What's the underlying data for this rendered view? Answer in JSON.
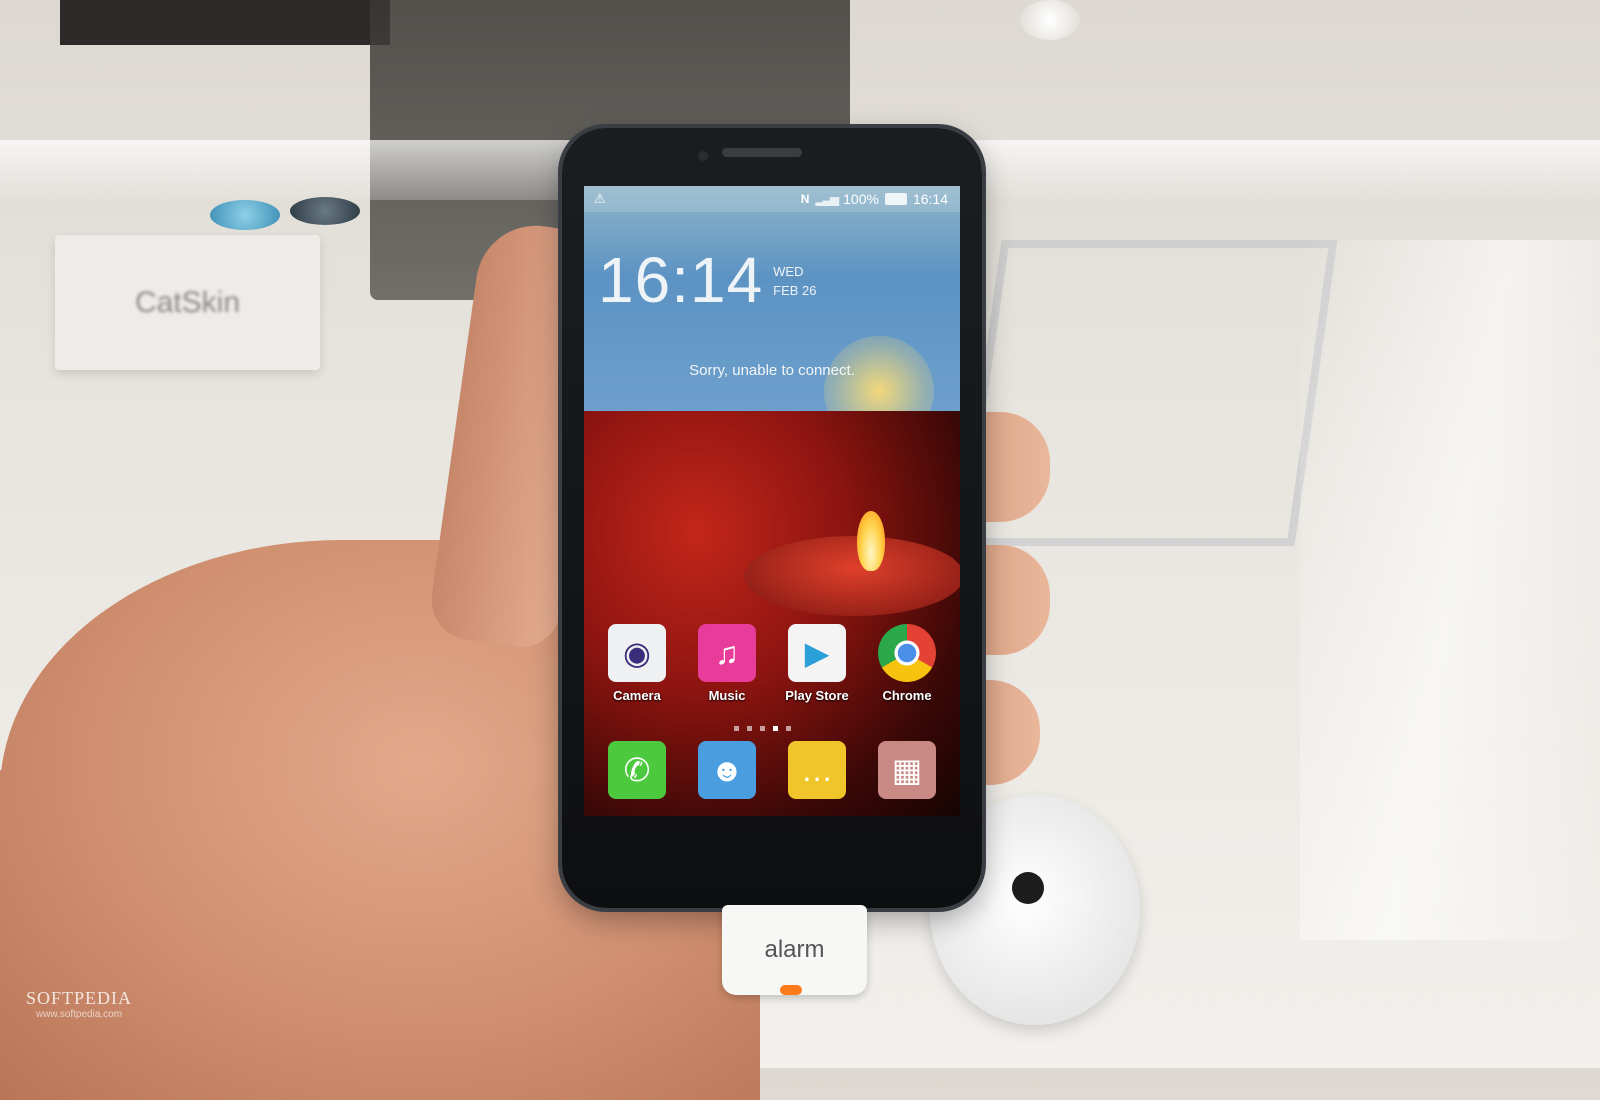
{
  "scene": {
    "background_card_text": "CatSkin",
    "alarm_label": "alarm"
  },
  "phone": {
    "status_bar": {
      "battery": "100%",
      "time": "16:14"
    },
    "clock_widget": {
      "time": "16:14",
      "day": "WED",
      "date": "FEB 26"
    },
    "weather_message": "Sorry, unable to connect.",
    "home_apps": [
      {
        "label": "Camera",
        "icon": "camera-icon"
      },
      {
        "label": "Music",
        "icon": "music-note-icon"
      },
      {
        "label": "Play Store",
        "icon": "play-store-icon"
      },
      {
        "label": "Chrome",
        "icon": "chrome-icon"
      }
    ],
    "dock_apps": [
      {
        "icon": "phone-icon"
      },
      {
        "icon": "contacts-icon"
      },
      {
        "icon": "messages-icon"
      },
      {
        "icon": "app-drawer-icon"
      }
    ],
    "page_indicator": {
      "pages": 5,
      "active": 4
    }
  },
  "watermark": {
    "brand": "SOFTPEDIA",
    "url": "www.softpedia.com"
  }
}
